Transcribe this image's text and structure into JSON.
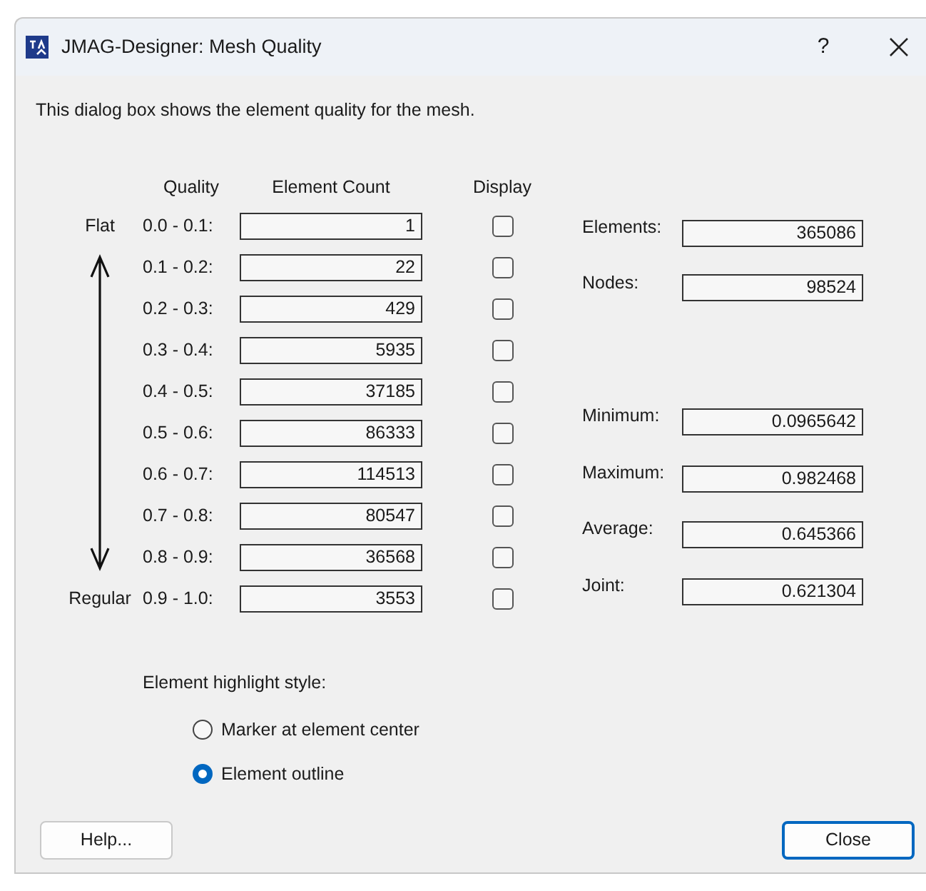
{
  "window": {
    "title": "JMAG-Designer: Mesh Quality",
    "help": "?"
  },
  "description": "This dialog box shows the element quality for the mesh.",
  "columns": [
    "Quality",
    "Element Count",
    "Display"
  ],
  "scale": {
    "top": "Flat",
    "bottom": "Regular"
  },
  "bins": [
    {
      "range": "0.0 - 0.1:",
      "count": "1",
      "display": false
    },
    {
      "range": "0.1 - 0.2:",
      "count": "22",
      "display": false
    },
    {
      "range": "0.2 - 0.3:",
      "count": "429",
      "display": false
    },
    {
      "range": "0.3 - 0.4:",
      "count": "5935",
      "display": false
    },
    {
      "range": "0.4 - 0.5:",
      "count": "37185",
      "display": false
    },
    {
      "range": "0.5 - 0.6:",
      "count": "86333",
      "display": false
    },
    {
      "range": "0.6 - 0.7:",
      "count": "114513",
      "display": false
    },
    {
      "range": "0.7 - 0.8:",
      "count": "80547",
      "display": false
    },
    {
      "range": "0.8 - 0.9:",
      "count": "36568",
      "display": false
    },
    {
      "range": "0.9 - 1.0:",
      "count": "3553",
      "display": false
    }
  ],
  "mesh_counts": [
    {
      "label": "Elements:",
      "value": "365086"
    },
    {
      "label": "Nodes:",
      "value": "98524"
    }
  ],
  "quality_stats": [
    {
      "label": "Minimum:",
      "value": "0.0965642"
    },
    {
      "label": "Maximum:",
      "value": "0.982468"
    },
    {
      "label": "Average:",
      "value": "0.645366"
    },
    {
      "label": "Joint:",
      "value": "0.621304"
    }
  ],
  "highlight_style": {
    "label": "Element highlight style:",
    "options": [
      {
        "label": "Marker at element center",
        "selected": false
      },
      {
        "label": "Element outline",
        "selected": true
      }
    ]
  },
  "buttons": [
    {
      "label": "Help...",
      "default": false
    },
    {
      "label": "Close",
      "default": true
    }
  ]
}
